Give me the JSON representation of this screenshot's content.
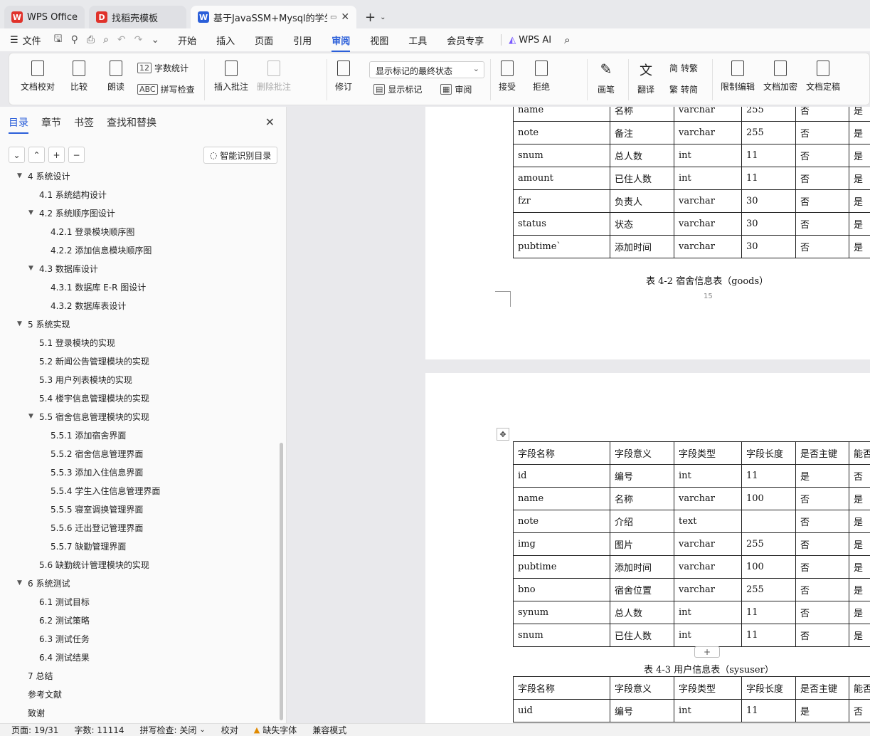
{
  "tabs": [
    {
      "label": "WPS Office",
      "logo": "W",
      "color": "#e0322b"
    },
    {
      "label": "找稻壳模板",
      "logo": "D",
      "color": "#e0322b"
    },
    {
      "label": "基于JavaSSM+Mysql的学生",
      "logo": "W",
      "color": "#2b5fd9"
    }
  ],
  "menu": {
    "file": "文件",
    "tabs": [
      "开始",
      "插入",
      "页面",
      "引用",
      "审阅",
      "视图",
      "工具",
      "会员专享"
    ],
    "active": "审阅",
    "ai": "WPS AI"
  },
  "ribbon": {
    "doc_check": "文档校对",
    "compare": "比较",
    "read_aloud": "朗读",
    "word_count": "字数统计",
    "spell_check": "拼写检查",
    "insert_comment": "插入批注",
    "delete_comment": "删除批注",
    "revise": "修订",
    "markup_state": "显示标记的最终状态",
    "show_markup": "显示标记",
    "review": "审阅",
    "accept": "接受",
    "reject": "拒绝",
    "pen": "画笔",
    "translate": "翻译",
    "to_traditional": "转繁",
    "to_simplified": "转简",
    "restrict_edit": "限制编辑",
    "encrypt": "文档加密",
    "finalize": "文档定稿"
  },
  "nav": {
    "tabs": [
      "目录",
      "章节",
      "书签",
      "查找和替换"
    ],
    "smart_btn": "智能识别目录",
    "toc": [
      {
        "text": "4  系统设计",
        "level": 0,
        "arrow": true
      },
      {
        "text": "4.1  系统结构设计",
        "level": 1,
        "arrow": false
      },
      {
        "text": "4.2  系统顺序图设计",
        "level": 1,
        "arrow": true
      },
      {
        "text": "4.2.1 登录模块顺序图",
        "level": 2,
        "arrow": false
      },
      {
        "text": "4.2.2 添加信息模块顺序图",
        "level": 2,
        "arrow": false
      },
      {
        "text": "4.3  数据库设计",
        "level": 1,
        "arrow": true
      },
      {
        "text": "4.3.1 数据库 E-R 图设计",
        "level": 2,
        "arrow": false
      },
      {
        "text": "4.3.2 数据库表设计",
        "level": 2,
        "arrow": false
      },
      {
        "text": "5  系统实现",
        "level": 0,
        "arrow": true
      },
      {
        "text": "5.1  登录模块的实现",
        "level": 1,
        "arrow": false
      },
      {
        "text": "5.2  新闻公告管理模块的实现",
        "level": 1,
        "arrow": false
      },
      {
        "text": "5.3  用户列表模块的实现",
        "level": 1,
        "arrow": false
      },
      {
        "text": "5.4  楼宇信息管理模块的实现",
        "level": 1,
        "arrow": false
      },
      {
        "text": "5.5  宿舍信息管理模块的实现",
        "level": 1,
        "arrow": true
      },
      {
        "text": "5.5.1 添加宿舍界面",
        "level": 2,
        "arrow": false
      },
      {
        "text": "5.5.2 宿舍信息管理界面",
        "level": 2,
        "arrow": false
      },
      {
        "text": "5.5.3 添加入住信息界面",
        "level": 2,
        "arrow": false
      },
      {
        "text": "5.5.4 学生入住信息管理界面",
        "level": 2,
        "arrow": false
      },
      {
        "text": "5.5.5 寝室调换管理界面",
        "level": 2,
        "arrow": false
      },
      {
        "text": "5.5.6 迁出登记管理界面",
        "level": 2,
        "arrow": false
      },
      {
        "text": "5.5.7 缺勤管理界面",
        "level": 2,
        "arrow": false
      },
      {
        "text": "5.6  缺勤统计管理模块的实现",
        "level": 1,
        "arrow": false
      },
      {
        "text": "6  系统测试",
        "level": 0,
        "arrow": true
      },
      {
        "text": "6.1  测试目标",
        "level": 1,
        "arrow": false
      },
      {
        "text": "6.2  测试策略",
        "level": 1,
        "arrow": false
      },
      {
        "text": "6.3  测试任务",
        "level": 1,
        "arrow": false
      },
      {
        "text": "6.4  测试结果",
        "level": 1,
        "arrow": false
      },
      {
        "text": "7  总结",
        "level": 0,
        "arrow": false
      },
      {
        "text": "参考文献",
        "level": 0,
        "arrow": false
      },
      {
        "text": "致谢",
        "level": 0,
        "arrow": false
      }
    ]
  },
  "doc": {
    "table1_rows": [
      [
        "name",
        "名称",
        "varchar",
        "255",
        "否",
        "是"
      ],
      [
        "note",
        "备注",
        "varchar",
        "255",
        "否",
        "是"
      ],
      [
        "snum",
        "总人数",
        "int",
        "11",
        "否",
        "是"
      ],
      [
        "amount",
        "已住人数",
        "int",
        "11",
        "否",
        "是"
      ],
      [
        "fzr",
        "负责人",
        "varchar",
        "30",
        "否",
        "是"
      ],
      [
        "status",
        "状态",
        "varchar",
        "30",
        "否",
        "是"
      ],
      [
        "pubtime`",
        "添加时间",
        "varchar",
        "30",
        "否",
        "是"
      ]
    ],
    "caption1": "表 4-2  宿舍信息表（goods）",
    "page_number": "15",
    "table2_header": [
      "字段名称",
      "字段意义",
      "字段类型",
      "字段长度",
      "是否主键",
      "能否"
    ],
    "table2_rows": [
      [
        "id",
        "编号",
        "int",
        "11",
        "是",
        "否"
      ],
      [
        "name",
        "名称",
        "varchar",
        "100",
        "否",
        "是"
      ],
      [
        "note",
        "介绍",
        "text",
        "",
        "否",
        "是"
      ],
      [
        "img",
        "图片",
        "varchar",
        "255",
        "否",
        "是"
      ],
      [
        "pubtime",
        "添加时间",
        "varchar",
        "100",
        "否",
        "是"
      ],
      [
        "bno",
        "宿舍位置",
        "varchar",
        "255",
        "否",
        "是"
      ],
      [
        "synum",
        "总人数",
        "int",
        "11",
        "否",
        "是"
      ],
      [
        "snum",
        "已住人数",
        "int",
        "11",
        "否",
        "是"
      ]
    ],
    "caption2": "表 4-3  用户信息表（sysuser）",
    "table3_header": [
      "字段名称",
      "字段意义",
      "字段类型",
      "字段长度",
      "是否主键",
      "能否"
    ],
    "table3_rows": [
      [
        "uid",
        "编号",
        "int",
        "11",
        "是",
        "否"
      ]
    ]
  },
  "status": {
    "page": "页面: 19/31",
    "words": "字数: 11114",
    "spell": "拼写检查: 关闭",
    "proof": "校对",
    "missing_font": "缺失字体",
    "compat": "兼容模式"
  }
}
